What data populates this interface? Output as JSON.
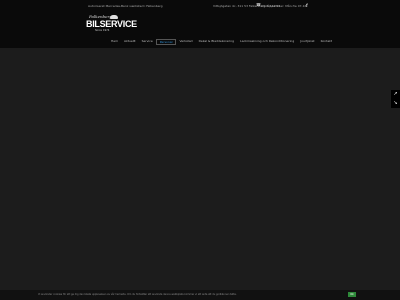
{
  "header": {
    "tagline": "Autoriseret Mercedes-Benz værksted i Falkenberg",
    "address": "Vittsjögatan 4c, 311 53 Falkenberg. Öppettider: Mån-fre 07-16",
    "phone": "0346-141 99",
    "phone_icon": "phone-icon",
    "social_icon": "facebook-icon"
  },
  "logo": {
    "script_text": "Falkenbergs",
    "brand_text": "BILSERVICE",
    "tag_text": "Since 1974"
  },
  "nav": {
    "items": [
      {
        "label": "Hem",
        "active": false
      },
      {
        "label": "Aktuellt",
        "active": false
      },
      {
        "label": "Service",
        "active": false
      },
      {
        "label": "Personal",
        "active": true
      },
      {
        "label": "Verkstad",
        "active": false
      },
      {
        "label": "Dekal & Bladdekorering",
        "active": false
      },
      {
        "label": "Lackmaskning och Rekonditionering",
        "active": false
      },
      {
        "label": "Jourtjänst",
        "active": false
      },
      {
        "label": "Kontakt",
        "active": false
      }
    ]
  },
  "side_widget": {
    "up_icon": "arrow-up-icon",
    "down_icon": "arrow-down-icon"
  },
  "cookie": {
    "text": "Vi använder cookies för att ge dig den bästa upplevelsen av vår hemsida. Om du fortsätter att använda denna webbplats kommer vi att anta att du godkänner detta.",
    "button_label": "Ok"
  },
  "colors": {
    "background": "#1c1c1c",
    "topbar": "#0a0a0a",
    "accent": "#2f8fd6",
    "cookie_button": "#2e8a3a"
  }
}
